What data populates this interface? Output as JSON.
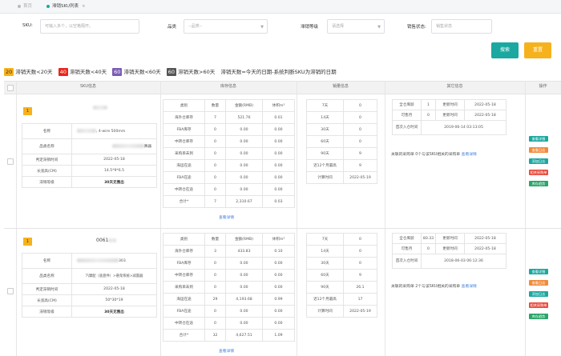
{
  "tabs": [
    {
      "label": "首页"
    },
    {
      "label": "滞销SKU列表",
      "close": "×"
    }
  ],
  "filters": {
    "sku_label": "SKU:",
    "sku_placeholder": "可输入多个，以空格隔开。",
    "category_label": "品类",
    "category_placeholder": "--品类--",
    "level_label": "滞销等级",
    "level_placeholder": "请选择",
    "status_label": "销售状态:",
    "status_placeholder": "销售状态"
  },
  "buttons": {
    "search": "搜索",
    "reset": "重置"
  },
  "legend": [
    {
      "code": "20",
      "text": "滞销天数<20天",
      "color": "#f6b21c",
      "fg": "#333"
    },
    {
      "code": "40",
      "text": "滞销天数<40天",
      "color": "#e8261d",
      "fg": "#fff"
    },
    {
      "code": "60",
      "text": "滞销天数<60天",
      "color": "#7a5bb5",
      "fg": "#fff"
    },
    {
      "code": "60",
      "text": "滞销天数>60天",
      "color": "#555555",
      "fg": "#fff"
    }
  ],
  "legend_note": "滞销天数=今天的日期-系统判断SKU为滞销的日期",
  "headers": {
    "sku": "SKU信息",
    "inventory": "库存信息",
    "sales": "销量信息",
    "other": "其它信息",
    "ops": "操作"
  },
  "inv_headers": [
    "类别",
    "数量",
    "金额(RMB)",
    "体积m³"
  ],
  "view_detail": "查看详情",
  "ops": [
    "查看详细",
    "查看日志",
    "添加日志",
    "相关采购单",
    "库存趋势"
  ],
  "rows": [
    {
      "badge": "1",
      "sku_id": "",
      "fields": [
        {
          "label": "名称",
          "value": ", 4-wire 500mm"
        },
        {
          "label": "品类名称",
          "value": "赛器"
        },
        {
          "label": "判定滞销时间",
          "value": "2022-05-18"
        },
        {
          "label": "长宽高(CM)",
          "value": "14.5*9*6.5"
        },
        {
          "label": "滞销等级",
          "value": "30天无售出"
        }
      ],
      "inventory": [
        [
          "海外仓库存",
          "7",
          "521.76",
          "0.01"
        ],
        [
          "FBA库存",
          "0",
          "0.00",
          "0.00"
        ],
        [
          "中转仓库存",
          "0",
          "0.00",
          "0.00"
        ],
        [
          "采购单未到",
          "0",
          "0.00",
          "0.00"
        ],
        [
          "海运在途",
          "0",
          "0.00",
          "0.00"
        ],
        [
          "FBA在途",
          "0",
          "0.00",
          "0.00"
        ],
        [
          "中转仓在途",
          "0",
          "0.00",
          "0.00"
        ],
        [
          "合计*",
          "7",
          "2,310.67",
          "0.03"
        ]
      ],
      "sales": [
        [
          "7天",
          "0"
        ],
        [
          "14天",
          "0"
        ],
        [
          "30天",
          "0"
        ],
        [
          "60天",
          "0"
        ],
        [
          "90天",
          "9"
        ],
        [
          "近12个月最高",
          "9"
        ],
        [
          "计算时间",
          "2022-05-19"
        ]
      ],
      "other": [
        [
          "全仓库龄",
          "1",
          "更新时间",
          "2022-05-18"
        ],
        [
          "可售月",
          "0",
          "更新时间",
          "2022-05-18"
        ]
      ],
      "first_in": {
        "label": "首次入仓时间",
        "value": "2019-06-14 03:13:05"
      },
      "po_note": "关联的采购单 0个与该SKU相关的采购单",
      "po_link": "查看详情"
    },
    {
      "badge": "1",
      "sku_id": "0061",
      "fields": [
        {
          "label": "名称",
          "value": "303"
        },
        {
          "label": "品类名称",
          "value": "汽摩配（底盘件）>悬架系统>减震器"
        },
        {
          "label": "判定滞销时间",
          "value": "2022-05-18"
        },
        {
          "label": "长宽高(CM)",
          "value": "50*30*19"
        },
        {
          "label": "滞销等级",
          "value": "30天无售出"
        }
      ],
      "inventory": [
        [
          "海外仓库存",
          "3",
          "433.83",
          "0.10"
        ],
        [
          "FBA库存",
          "0",
          "0.00",
          "0.00"
        ],
        [
          "中转仓库存",
          "0",
          "0.00",
          "0.00"
        ],
        [
          "采购单未到",
          "0",
          "0.00",
          "0.00"
        ],
        [
          "海运在途",
          "29",
          "4,193.68",
          "0.99"
        ],
        [
          "FBA在途",
          "0",
          "0.00",
          "0.00"
        ],
        [
          "中转仓在途",
          "0",
          "0.00",
          "0.00"
        ],
        [
          "合计*",
          "32",
          "4,627.51",
          "1.09"
        ]
      ],
      "sales": [
        [
          "7天",
          "0"
        ],
        [
          "14天",
          "0"
        ],
        [
          "30天",
          "0"
        ],
        [
          "60天",
          "9"
        ],
        [
          "90天",
          "26.1"
        ],
        [
          "近12个月最高",
          "17"
        ],
        [
          "计算时间",
          "2022-05-19"
        ]
      ],
      "other": [
        [
          "全仓库龄",
          "80.33",
          "更新时间",
          "2022-05-18"
        ],
        [
          "可售月",
          "0",
          "更新时间",
          "2022-05-18"
        ]
      ],
      "first_in": {
        "label": "首次入仓时间",
        "value": "2018-06-03 06:12:36"
      },
      "po_note": "关联的采购单 2个与该SKU相关的采购单",
      "po_link": "查看详情"
    }
  ]
}
